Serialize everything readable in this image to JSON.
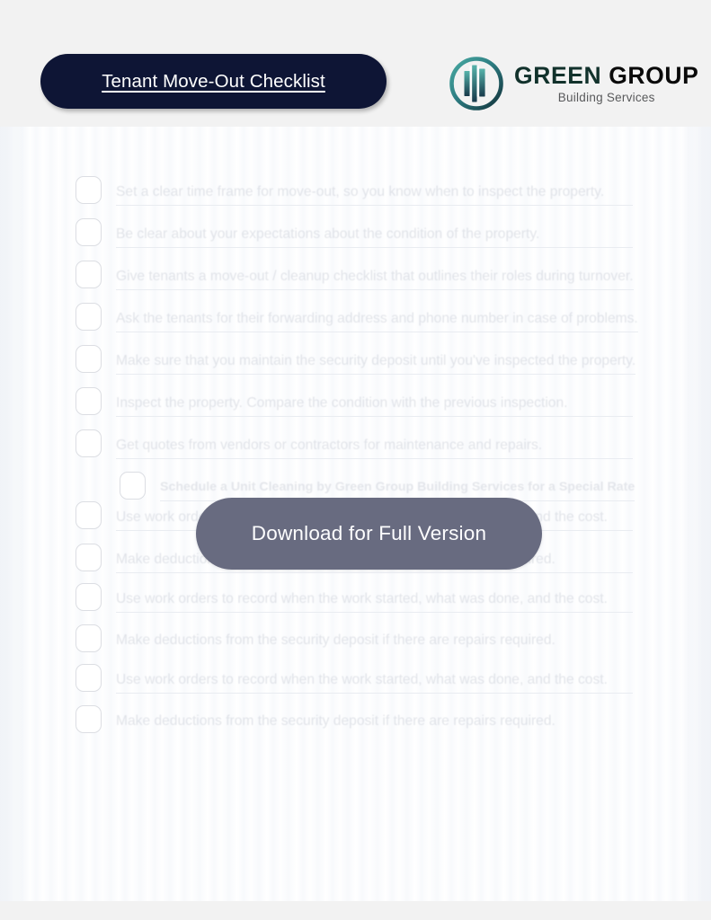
{
  "header": {
    "title": "Tenant Move-Out Checklist",
    "brand": {
      "mark_icon": "green-group-circular-building-logo",
      "name_part1": "GREEN",
      "name_part2": "GROUP",
      "tagline": "Building Services",
      "color_primary": "#12322c",
      "color_secondary": "#0a0a0a",
      "color_tagline": "#58595b",
      "mark_gradient_from": "#3fa39b",
      "mark_gradient_to": "#13343a"
    },
    "title_pill_color": "#0e1535"
  },
  "cta": {
    "label": "Download for Full Version",
    "color": "#686b80",
    "text_color": "#fdfdfe"
  },
  "checklist": {
    "items": [
      {
        "text": "Set a clear time frame for move-out, so you know when to inspect the property.",
        "checked": false,
        "emphasis": false,
        "indent": false,
        "rule": true
      },
      {
        "text": "Be clear about your expectations about the condition of the property.",
        "checked": false,
        "emphasis": false,
        "indent": false,
        "rule": true
      },
      {
        "text": "Give tenants a move-out / cleanup checklist that outlines their roles during turnover.",
        "checked": false,
        "emphasis": false,
        "indent": false,
        "rule": true
      },
      {
        "text": "Ask the tenants for their forwarding address and phone number in case of problems.",
        "checked": false,
        "emphasis": false,
        "indent": false,
        "rule": true
      },
      {
        "text": "Make sure that you maintain the security deposit until you've inspected the property.",
        "checked": false,
        "emphasis": false,
        "indent": false,
        "rule": true
      },
      {
        "text": "Inspect the property. Compare the condition with the previous inspection.",
        "checked": false,
        "emphasis": false,
        "indent": false,
        "rule": true
      },
      {
        "text": "Get quotes from vendors or contractors for maintenance and repairs.",
        "checked": false,
        "emphasis": false,
        "indent": false,
        "rule": true
      },
      {
        "text": "Schedule a Unit Cleaning by Green Group Building Services for a Special Rate",
        "checked": false,
        "emphasis": true,
        "indent": true,
        "rule": true
      },
      {
        "text": "Use work orders to record when the work started, what was done, and the cost.",
        "checked": false,
        "emphasis": false,
        "indent": false,
        "rule": true
      },
      {
        "text": "Make deductions from the security deposit if there are repairs required.",
        "checked": false,
        "emphasis": false,
        "indent": false,
        "rule": true
      },
      {
        "text": "Use work orders to record when the work started, what was done, and the cost.",
        "checked": false,
        "emphasis": false,
        "indent": false,
        "rule": true
      },
      {
        "text": "Make deductions from the security deposit if there are repairs required.",
        "checked": false,
        "emphasis": false,
        "indent": false,
        "rule": false
      },
      {
        "text": "Use work orders to record when the work started, what was done, and the cost.",
        "checked": false,
        "emphasis": false,
        "indent": false,
        "rule": true
      },
      {
        "text": "Make deductions from the security deposit if there are repairs required.",
        "checked": false,
        "emphasis": false,
        "indent": false,
        "rule": false
      }
    ],
    "checkbox_icon": "empty-checkbox-icon"
  },
  "page": {
    "background": "#f2f2f2",
    "sheet_background": "#ffffff"
  }
}
